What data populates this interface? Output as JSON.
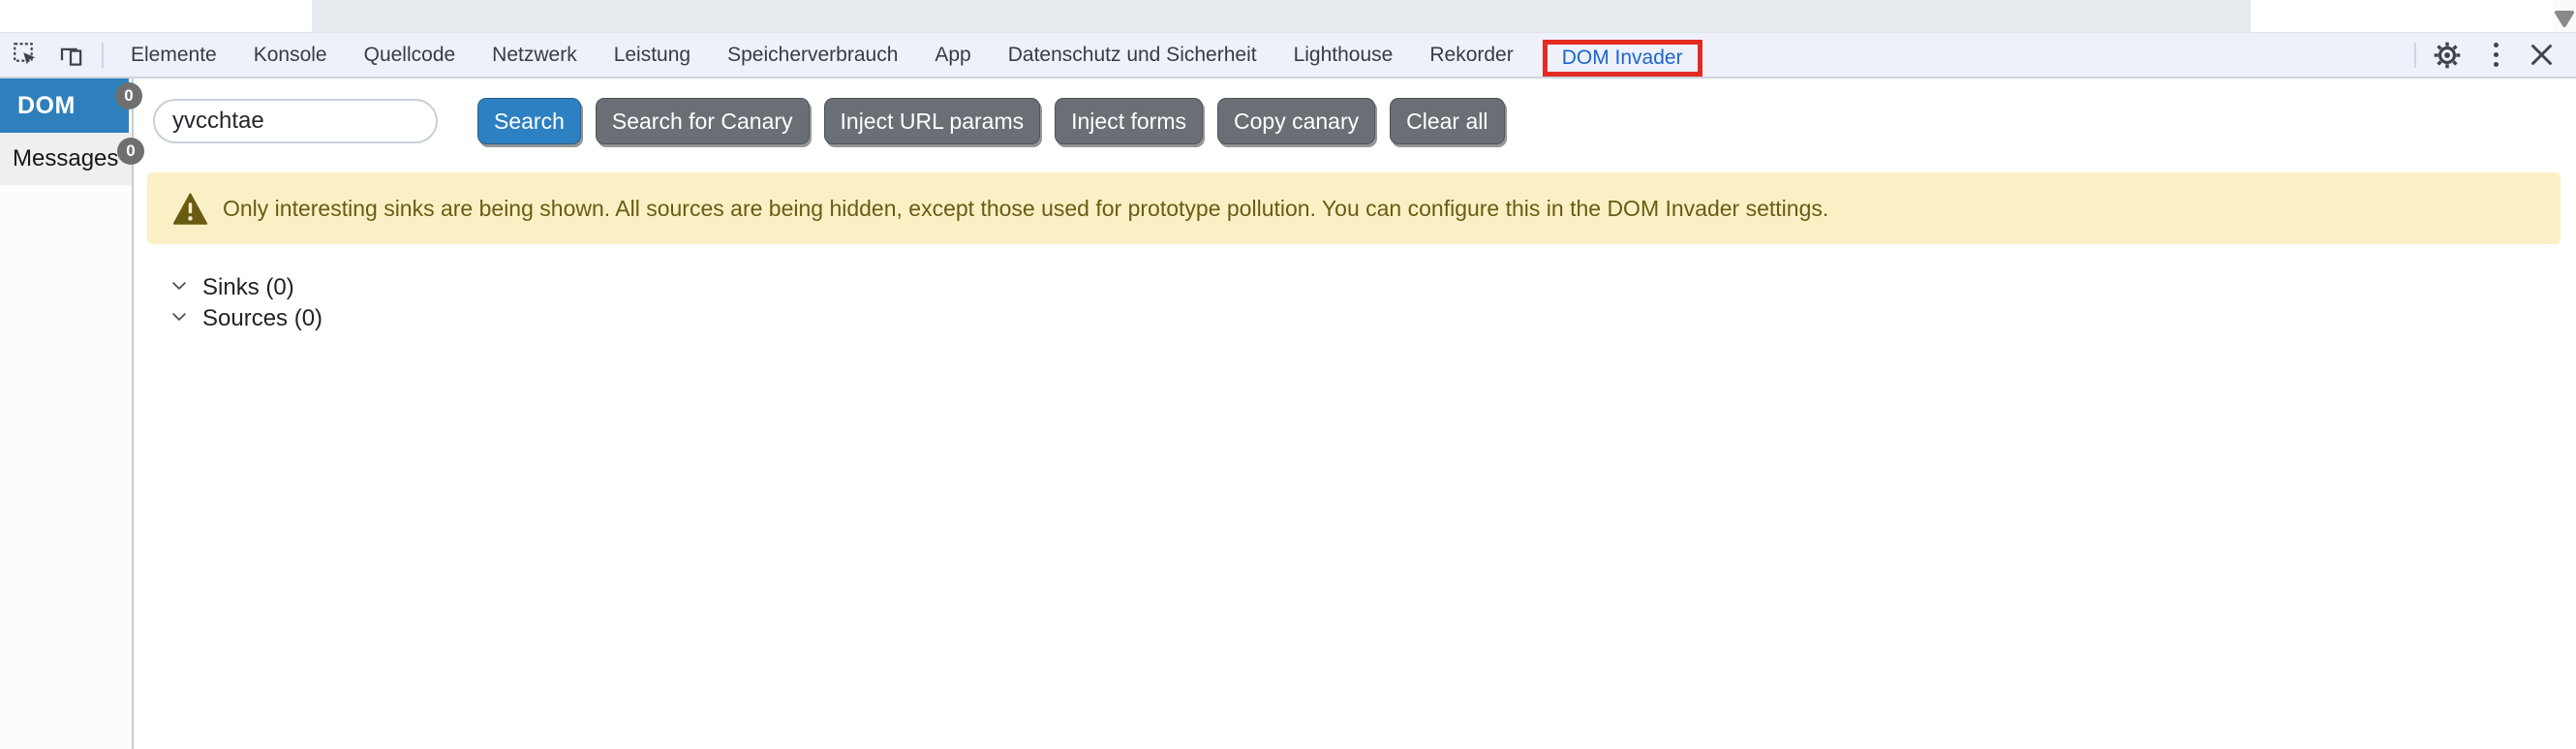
{
  "toolbar": {
    "tabs": [
      {
        "label": "Elemente",
        "active": false
      },
      {
        "label": "Konsole",
        "active": false
      },
      {
        "label": "Quellcode",
        "active": false
      },
      {
        "label": "Netzwerk",
        "active": false
      },
      {
        "label": "Leistung",
        "active": false
      },
      {
        "label": "Speicherverbrauch",
        "active": false
      },
      {
        "label": "App",
        "active": false
      },
      {
        "label": "Datenschutz und Sicherheit",
        "active": false
      },
      {
        "label": "Lighthouse",
        "active": false
      },
      {
        "label": "Rekorder",
        "active": false
      },
      {
        "label": "DOM Invader",
        "active": true
      }
    ],
    "icons": [
      "inspect-element-icon",
      "toggle-device-toolbar-icon",
      "settings-gear-icon",
      "more-options-kebab-icon",
      "close-icon"
    ]
  },
  "sidebar": {
    "items": [
      {
        "label": "DOM",
        "badge": "0",
        "active": true
      },
      {
        "label": "Messages",
        "badge": "0",
        "active": false
      }
    ]
  },
  "controls": {
    "search": {
      "value": "yvcchtae"
    },
    "buttons": [
      {
        "label": "Search",
        "style": "primary"
      },
      {
        "label": "Search for Canary",
        "style": "gray"
      },
      {
        "label": "Inject URL params",
        "style": "gray"
      },
      {
        "label": "Inject forms",
        "style": "gray"
      },
      {
        "label": "Copy canary",
        "style": "gray"
      },
      {
        "label": "Clear all",
        "style": "gray"
      }
    ]
  },
  "banner": {
    "text": "Only interesting sinks are being shown. All sources are being hidden, except those used for prototype pollution. You can configure this in the DOM Invader settings."
  },
  "sections": [
    {
      "label": "Sinks (0)"
    },
    {
      "label": "Sources (0)"
    }
  ],
  "colors": {
    "accent_blue": "#2e7fbc",
    "button_blue": "#2d80c2",
    "button_gray": "#6a6f76",
    "highlight_red": "#e32b22",
    "active_tab_text": "#1a66d2",
    "warning_bg": "#fbf0c5",
    "warning_text": "#6a5b13",
    "badge_gray": "#6f6f6f"
  }
}
